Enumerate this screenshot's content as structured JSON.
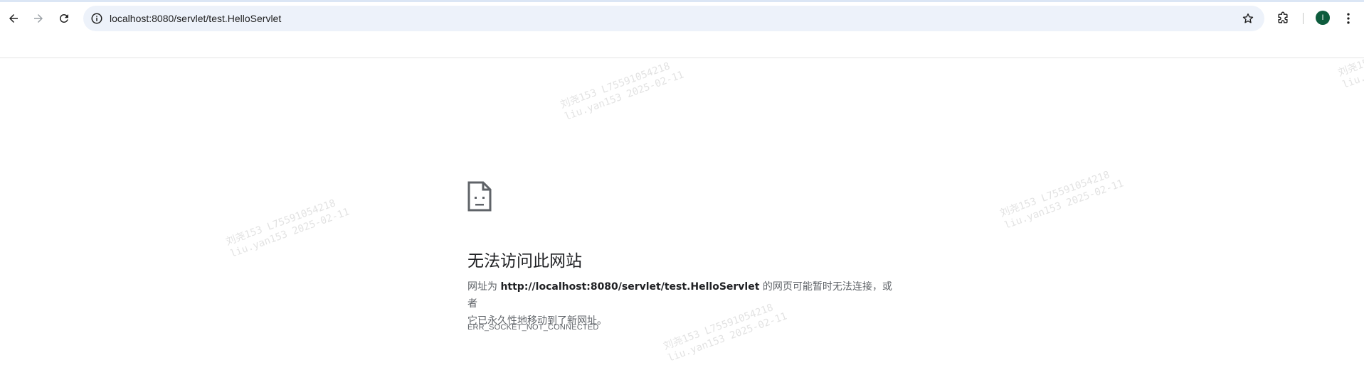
{
  "browser": {
    "url": "localhost:8080/servlet/test.HelloServlet",
    "avatar_letter": "I",
    "accent_color": "#0d5c3d"
  },
  "icons": {
    "back": "arrow-left-icon",
    "forward": "arrow-right-icon",
    "reload": "reload-icon",
    "site_info": "info-icon",
    "bookmark": "star-icon",
    "extensions": "puzzle-icon",
    "menu": "kebab-menu-icon",
    "error": "sad-page-icon"
  },
  "error": {
    "title": "无法访问此网站",
    "desc_prefix": "网址为 ",
    "desc_url": "http://localhost:8080/servlet/test.HelloServlet",
    "desc_line1_suffix": " 的网页可能暂时无法连接，或者",
    "desc_line2": "它已永久性地移动到了新网址。",
    "code": "ERR_SOCKET_NOT_CONNECTED"
  },
  "watermark": {
    "line1": "刘尧153 L75591054218",
    "line2": "liu.yan153 2025-02-11"
  }
}
